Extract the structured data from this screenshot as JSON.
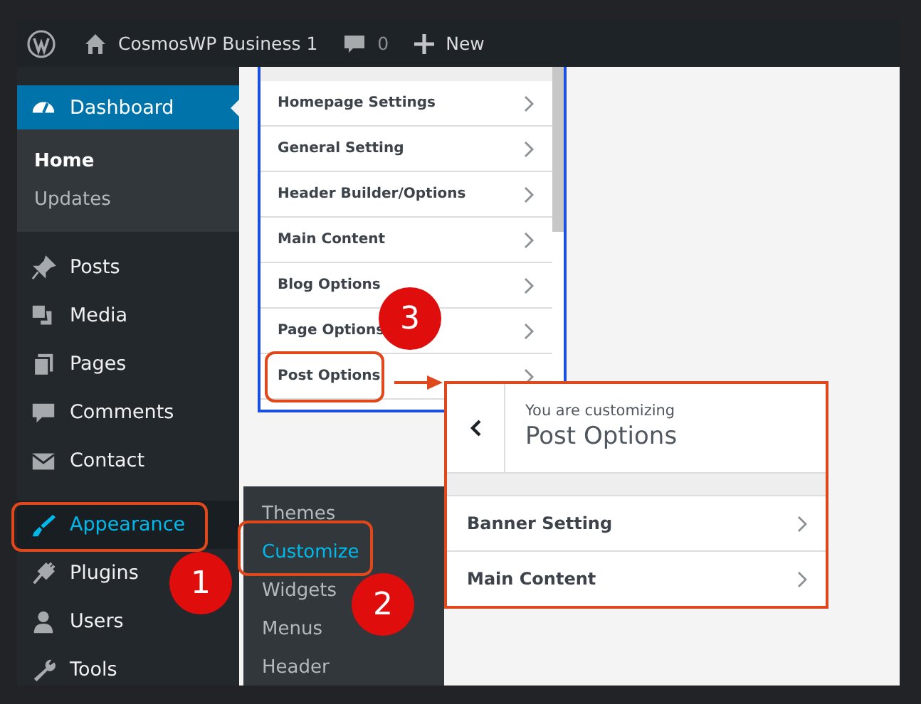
{
  "admin_bar": {
    "site_name": "CosmosWP Business 1",
    "comments_count": "0",
    "new_label": "New"
  },
  "sidebar": {
    "items": [
      {
        "label": "Dashboard",
        "selected": true,
        "hovered": false,
        "children": [
          {
            "label": "Home",
            "selected": true
          },
          {
            "label": "Updates",
            "selected": false
          }
        ]
      },
      {
        "label": "Posts",
        "selected": false,
        "hovered": false
      },
      {
        "label": "Media",
        "selected": false,
        "hovered": false
      },
      {
        "label": "Pages",
        "selected": false,
        "hovered": false
      },
      {
        "label": "Comments",
        "selected": false,
        "hovered": false
      },
      {
        "label": "Contact",
        "selected": false,
        "hovered": false
      },
      {
        "label": "Appearance",
        "selected": false,
        "hovered": true
      },
      {
        "label": "Plugins",
        "selected": false,
        "hovered": false
      },
      {
        "label": "Users",
        "selected": false,
        "hovered": false
      },
      {
        "label": "Tools",
        "selected": false,
        "hovered": false
      }
    ]
  },
  "appearance_flyout": {
    "items": [
      {
        "label": "Themes",
        "selected": false
      },
      {
        "label": "Customize",
        "selected": true
      },
      {
        "label": "Widgets",
        "selected": false
      },
      {
        "label": "Menus",
        "selected": false
      },
      {
        "label": "Header",
        "selected": false
      }
    ]
  },
  "customizer_panel": {
    "sections": [
      "Homepage Settings",
      "General Setting",
      "Header Builder/Options",
      "Main Content",
      "Blog Options",
      "Page Options",
      "Post Options"
    ]
  },
  "post_options_panel": {
    "caption": "You are customizing",
    "title": "Post Options",
    "sections": [
      "Banner Setting",
      "Main Content"
    ]
  },
  "callouts": [
    "1",
    "2",
    "3"
  ]
}
